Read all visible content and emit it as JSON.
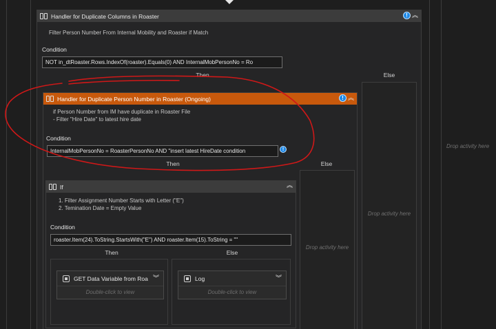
{
  "outer": {
    "title": "Handler for Duplicate Columns in Roaster",
    "description": "Filter Person Number From Internal Mobility and Roaster if Match",
    "condition_label": "Condition",
    "condition": "NOT in_dtRoaster.Rows.IndexOf(roaster).Equals(0) AND InternalMobPersonNo = Ro",
    "then_label": "Then",
    "else_label": "Else"
  },
  "inner": {
    "title": "Handler for Duplicate Person Number in Roaster (Ongoing)",
    "description": [
      "if Person Number from IM have duplicate in Roaster File",
      "- Filter \"Hire Date\" to latest hire date"
    ],
    "condition_label": "Condition",
    "condition": "InternalMobPersonNo = RoasterPersonNo AND \"insert latest HireDate condition",
    "then_label": "Then",
    "else_label": "Else"
  },
  "if_block": {
    "title": "If",
    "description": [
      "1. Filter Assignment Number Starts with Letter (\"E\")",
      "2. Temination Date =  Empty Value"
    ],
    "condition_label": "Condition",
    "condition": "roaster.Item(24).ToString.StartsWith(\"E\") AND roaster.Item(15).ToString = \"\"",
    "then_label": "Then",
    "else_label": "Else"
  },
  "activities": {
    "get_data": {
      "title": "GET Data Variable from Roa",
      "hint": "Double-click to view"
    },
    "log": {
      "title": "Log",
      "hint": "Double-click to view"
    }
  },
  "drop_text": "Drop activity here",
  "icons": {
    "info": "info-icon",
    "collapse": "chevron-up-icon",
    "expand": "chevron-down-icon"
  },
  "colors": {
    "orange_header": "#c8590c",
    "annotation": "#d01818",
    "info": "#1e88e5"
  }
}
